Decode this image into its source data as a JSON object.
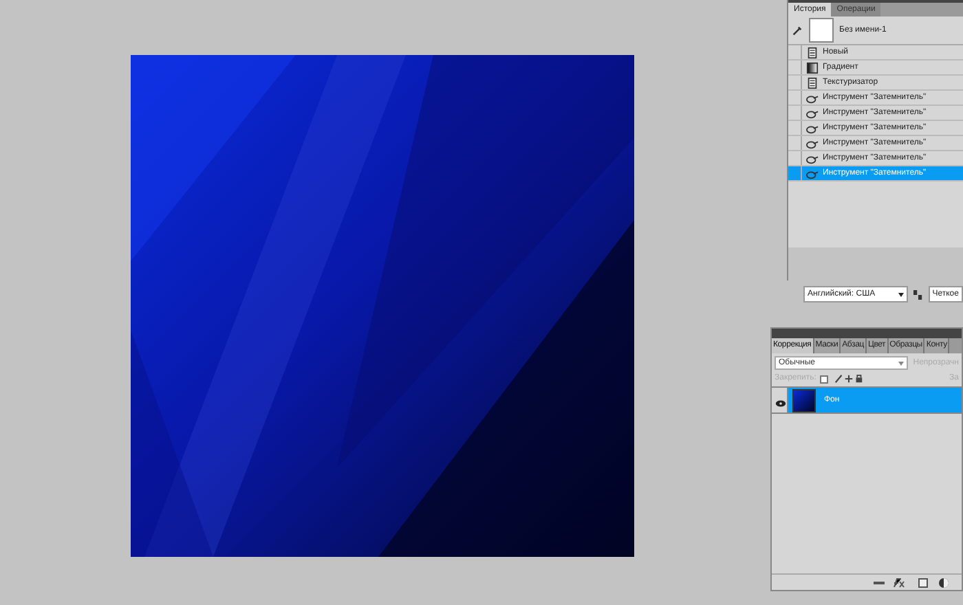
{
  "history": {
    "tabs": [
      {
        "label": "История",
        "selected": true
      },
      {
        "label": "Операции",
        "selected": false
      }
    ],
    "snapshot": "Без имени-1",
    "steps": [
      {
        "label": "Новый",
        "kind": "document",
        "selected": false
      },
      {
        "label": "Градиент",
        "kind": "gradient",
        "selected": false
      },
      {
        "label": "Текстуризатор",
        "kind": "document",
        "selected": false
      },
      {
        "label": "Инструмент \"Затемнитель\"",
        "kind": "burn",
        "selected": false
      },
      {
        "label": "Инструмент \"Затемнитель\"",
        "kind": "burn",
        "selected": false
      },
      {
        "label": "Инструмент \"Затемнитель\"",
        "kind": "burn",
        "selected": false
      },
      {
        "label": "Инструмент \"Затемнитель\"",
        "kind": "burn",
        "selected": false
      },
      {
        "label": "Инструмент \"Затемнитель\"",
        "kind": "burn",
        "selected": false
      },
      {
        "label": "Инструмент \"Затемнитель\"",
        "kind": "burn",
        "selected": true
      }
    ]
  },
  "text_options": {
    "language": "Английский: США",
    "antialias": "Четкое"
  },
  "layers": {
    "tabs": [
      {
        "label": "Коррекция",
        "selected": true
      },
      {
        "label": "Маски",
        "selected": false
      },
      {
        "label": "Абзац",
        "selected": false
      },
      {
        "label": "Цвет",
        "selected": false
      },
      {
        "label": "Образцы",
        "selected": false
      },
      {
        "label": "Конту",
        "selected": false
      }
    ],
    "blend_mode": "Обычные",
    "opacity_label": "Непрозрачн",
    "lock_label": "Закрепить:",
    "fill_label": "За",
    "items": [
      {
        "name": "Фон",
        "selected": true,
        "visible": true
      }
    ]
  }
}
